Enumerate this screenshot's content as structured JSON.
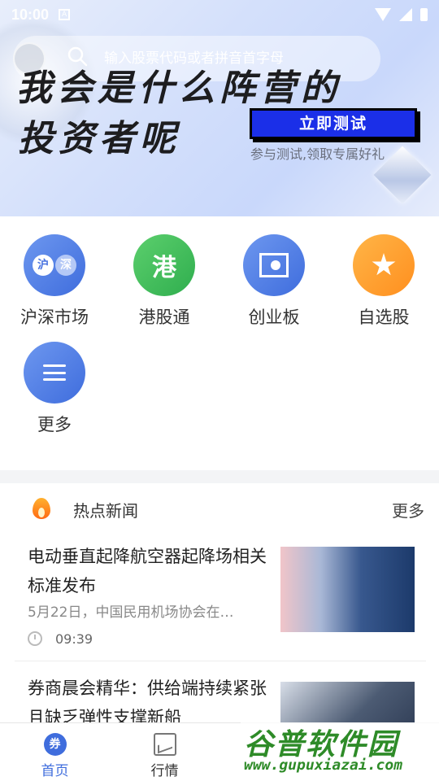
{
  "status_bar": {
    "time": "10:00",
    "indicator": "A"
  },
  "search": {
    "placeholder": "输入股票代码或者拼音首字母"
  },
  "banner": {
    "headline_line1": "我会是什么阵营的",
    "headline_line2": "投资者呢",
    "cta_label": "立即测试",
    "sub_text": "参与测试,领取专属好礼"
  },
  "menu": {
    "items": [
      {
        "label": "沪深市场",
        "icon": "hushen-icon",
        "glyph_a": "沪",
        "glyph_b": "深"
      },
      {
        "label": "港股通",
        "icon": "gang-icon",
        "glyph": "港"
      },
      {
        "label": "创业板",
        "icon": "board-icon"
      },
      {
        "label": "自选股",
        "icon": "star-icon"
      },
      {
        "label": "更多",
        "icon": "menu-icon"
      }
    ]
  },
  "news": {
    "section_title": "热点新闻",
    "more_label": "更多",
    "articles": [
      {
        "title": "电动垂直起降航空器起降场相关标准发布",
        "snippet": "5月22日，中国民用机场协会在…",
        "time": "09:39"
      },
      {
        "title": "券商晨会精华：供给端持续紧张且缺乏弹性支撑新船"
      }
    ]
  },
  "tabbar": {
    "tabs": [
      {
        "label": "首页",
        "glyph": "券",
        "active": true
      },
      {
        "label": "行情",
        "active": false
      }
    ]
  },
  "watermark": {
    "title": "谷普软件园",
    "url": "www.gupuxiazai.com"
  },
  "colors": {
    "accent": "#3f6ddd",
    "cta": "#1b2fe8",
    "green": "#2fae4e",
    "orange": "#ff8f1f"
  }
}
